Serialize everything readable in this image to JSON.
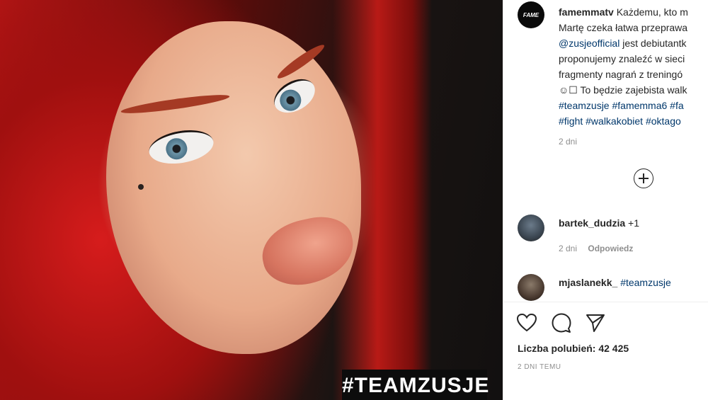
{
  "photo": {
    "hashtag_text": "#TEAMZUSJE"
  },
  "post": {
    "author_logo_text": "FAME",
    "author": "famemmatv",
    "caption_lines": [
      "Każdemu, kto m",
      "Martę czeka łatwa przeprawa",
      "jest debiutantk",
      "proponujemy znaleźć w sieci",
      "fragmenty nagrań z treningó",
      "☺☐ To będzie zajebista walk"
    ],
    "mention": "@zusjeofficial",
    "hashtag_line1": "#teamzusje #famemma6 #fa",
    "hashtag_line2": "#fight #walkakobiet #oktago",
    "caption_time": "2 dni"
  },
  "comments": [
    {
      "user": "bartek_dudzia",
      "text": "+1",
      "time": "2 dni",
      "reply_label": "Odpowiedz"
    },
    {
      "user": "mjaslanekk_",
      "text": "#teamzusje"
    }
  ],
  "actions": {
    "icons": [
      "heart-icon",
      "comment-icon",
      "share-icon"
    ]
  },
  "likes": {
    "label": "Liczba polubień: 42 425"
  },
  "post_date": "2 DNI TEMU"
}
